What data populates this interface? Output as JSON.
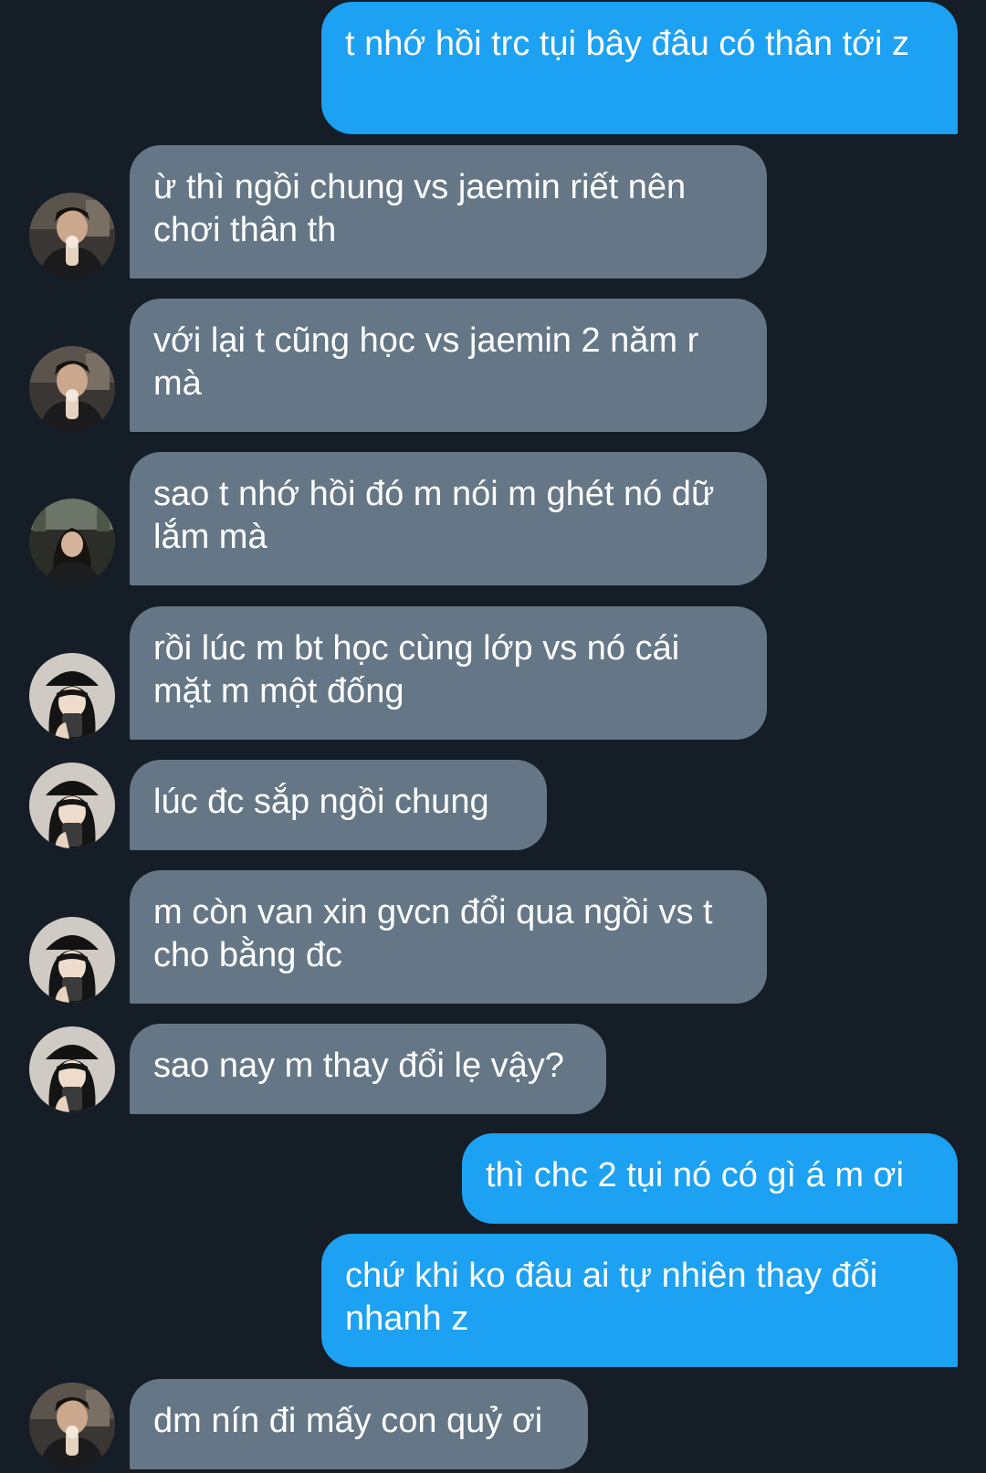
{
  "conversation": {
    "messages": [
      {
        "direction": "sent",
        "text": "t nhớ hồi trc tụi bây đâu có thân tới z"
      },
      {
        "direction": "received",
        "avatar": "boy-icecream-avatar-icon",
        "text": "ừ thì ngồi chung vs jaemin riết nên chơi thân th"
      },
      {
        "direction": "received",
        "avatar": "boy-icecream-avatar-icon",
        "text": "với lại t cũng học vs jaemin 2 năm r mà"
      },
      {
        "direction": "received",
        "avatar": "girl-outdoor-avatar-icon",
        "text": "sao t nhớ hồi đó m nói m ghét nó dữ lắm mà"
      },
      {
        "direction": "received",
        "avatar": "girl-cap-mirror-avatar-icon",
        "text": "rồi lúc m bt học cùng lớp vs nó cái mặt m một đống"
      },
      {
        "direction": "received",
        "avatar": "girl-cap-mirror-avatar-icon",
        "text": "lúc đc sắp ngồi chung"
      },
      {
        "direction": "received",
        "avatar": "girl-cap-mirror-avatar-icon",
        "text": "m còn van xin gvcn đổi qua ngồi vs t cho bằng đc"
      },
      {
        "direction": "received",
        "avatar": "girl-cap-mirror-avatar-icon",
        "text": "sao nay m thay đổi lẹ vậy?"
      },
      {
        "direction": "sent",
        "text": "thì chc 2 tụi nó có gì á m ơi"
      },
      {
        "direction": "sent",
        "text": "chứ khi ko đâu ai tự nhiên thay đổi nhanh z"
      },
      {
        "direction": "received",
        "avatar": "boy-icecream-avatar-icon",
        "text": "dm nín đi mấy con quỷ ơi"
      }
    ]
  },
  "colors": {
    "background": "#151d26",
    "sent_bubble": "#1da1f2",
    "received_bubble": "#657786",
    "text": "#ffffff"
  }
}
